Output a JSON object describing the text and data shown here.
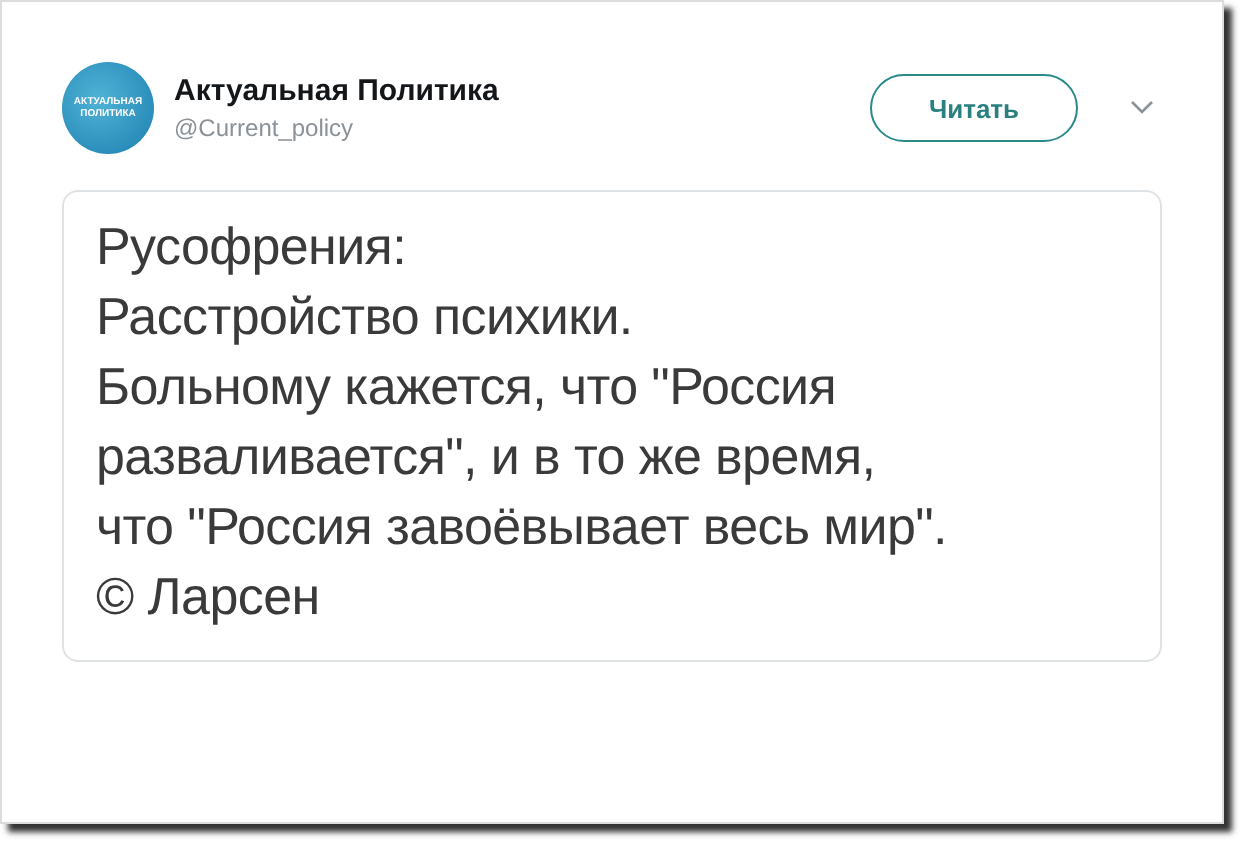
{
  "account": {
    "avatar_text": [
      "АКТУАЛЬНАЯ",
      "ПОЛИТИКА"
    ],
    "name": "Актуальная Политика",
    "handle": "@Current_policy"
  },
  "follow_button": "Читать",
  "tweet_image": {
    "lines": [
      "Русофрения:",
      "Расстройство психики.",
      "Больному кажется, что \"Россия",
      "разваливается\", и в то же время,",
      "что \"Россия завоёвывает весь мир\".",
      "© Ларсен"
    ]
  }
}
